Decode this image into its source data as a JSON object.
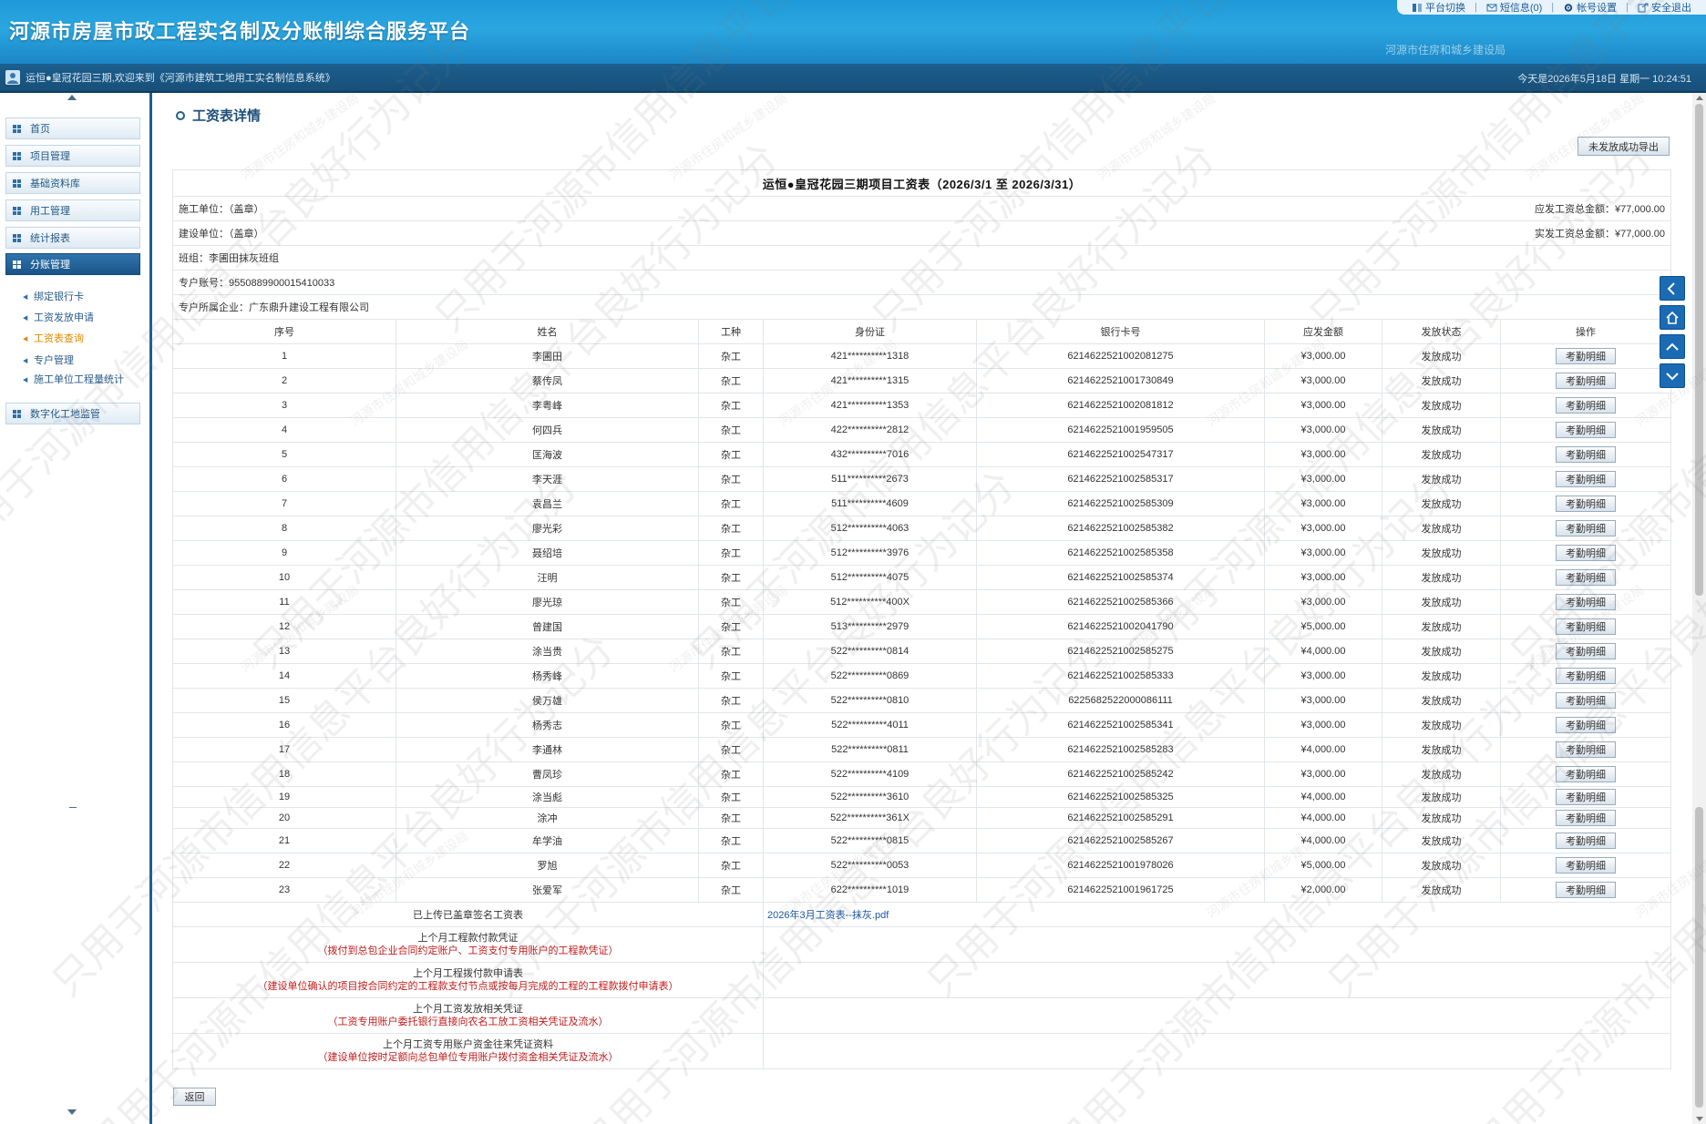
{
  "header": {
    "title": "河源市房屋市政工程实名制及分账制综合服务平台",
    "dept": "河源市住房和城乡建设局",
    "menu": {
      "switch": "平台切换",
      "messages": "短信息(0)",
      "account": "帐号设置",
      "logout": "安全退出",
      "separator": "|"
    }
  },
  "status": {
    "welcome": "运恒●皇冠花园三期,欢迎来到《河源市建筑工地用工实名制信息系统》",
    "date": "今天是2026年5月18日 星期一 10:24:51"
  },
  "sidebar": {
    "items": [
      {
        "label": "首页"
      },
      {
        "label": "项目管理"
      },
      {
        "label": "基础资料库"
      },
      {
        "label": "用工管理"
      },
      {
        "label": "统计报表"
      },
      {
        "label": "分账管理"
      }
    ],
    "subitems": [
      {
        "label": "绑定银行卡"
      },
      {
        "label": "工资发放申请"
      },
      {
        "label": "工资表查询"
      },
      {
        "label": "专户管理"
      },
      {
        "label": "施工单位工程量统计"
      }
    ],
    "extra": {
      "label": "数字化工地监管"
    }
  },
  "page": {
    "title": "工资表详情",
    "export_button": "未发放成功导出",
    "back_button": "返回"
  },
  "sheet": {
    "title": "运恒●皇冠花园三期项目工资表（2026/3/1 至 2026/3/31）",
    "constructor": "施工单位：（盖章）",
    "builder": "建设单位：（盖章）",
    "team": "班组：李圃田抹灰班组",
    "account": "专户账号：9550889900015410033",
    "enterprise": "专户所属企业：广东鼎升建设工程有限公司",
    "due_total": "应发工资总金额：¥77,000.00",
    "paid_total": "实发工资总金额：¥77,000.00",
    "columns": [
      "序号",
      "姓名",
      "工种",
      "身份证",
      "银行卡号",
      "应发金额",
      "发放状态",
      "操作"
    ],
    "detail_label": "考勤明细",
    "rows": [
      {
        "no": "1",
        "name": "李圃田",
        "job": "杂工",
        "id": "421**********1318",
        "card": "6214622521002081275",
        "amount": "¥3,000.00",
        "status": "发放成功"
      },
      {
        "no": "2",
        "name": "蔡传凤",
        "job": "杂工",
        "id": "421**********1315",
        "card": "6214622521001730849",
        "amount": "¥3,000.00",
        "status": "发放成功"
      },
      {
        "no": "3",
        "name": "李粤峰",
        "job": "杂工",
        "id": "421**********1353",
        "card": "6214622521002081812",
        "amount": "¥3,000.00",
        "status": "发放成功"
      },
      {
        "no": "4",
        "name": "何四兵",
        "job": "杂工",
        "id": "422**********2812",
        "card": "6214622521001959505",
        "amount": "¥3,000.00",
        "status": "发放成功"
      },
      {
        "no": "5",
        "name": "匡海波",
        "job": "杂工",
        "id": "432**********7016",
        "card": "6214622521002547317",
        "amount": "¥3,000.00",
        "status": "发放成功"
      },
      {
        "no": "6",
        "name": "李天涯",
        "job": "杂工",
        "id": "511**********2673",
        "card": "6214622521002585317",
        "amount": "¥3,000.00",
        "status": "发放成功"
      },
      {
        "no": "7",
        "name": "袁昌兰",
        "job": "杂工",
        "id": "511**********4609",
        "card": "6214622521002585309",
        "amount": "¥3,000.00",
        "status": "发放成功"
      },
      {
        "no": "8",
        "name": "廖光彩",
        "job": "杂工",
        "id": "512**********4063",
        "card": "6214622521002585382",
        "amount": "¥3,000.00",
        "status": "发放成功"
      },
      {
        "no": "9",
        "name": "聂绍培",
        "job": "杂工",
        "id": "512**********3976",
        "card": "6214622521002585358",
        "amount": "¥3,000.00",
        "status": "发放成功"
      },
      {
        "no": "10",
        "name": "汪明",
        "job": "杂工",
        "id": "512**********4075",
        "card": "6214622521002585374",
        "amount": "¥3,000.00",
        "status": "发放成功"
      },
      {
        "no": "11",
        "name": "廖光琼",
        "job": "杂工",
        "id": "512**********400X",
        "card": "6214622521002585366",
        "amount": "¥3,000.00",
        "status": "发放成功"
      },
      {
        "no": "12",
        "name": "曾建国",
        "job": "杂工",
        "id": "513**********2979",
        "card": "6214622521002041790",
        "amount": "¥5,000.00",
        "status": "发放成功"
      },
      {
        "no": "13",
        "name": "涂当贵",
        "job": "杂工",
        "id": "522**********0814",
        "card": "6214622521002585275",
        "amount": "¥4,000.00",
        "status": "发放成功"
      },
      {
        "no": "14",
        "name": "杨秀峰",
        "job": "杂工",
        "id": "522**********0869",
        "card": "6214622521002585333",
        "amount": "¥3,000.00",
        "status": "发放成功"
      },
      {
        "no": "15",
        "name": "侯万雄",
        "job": "杂工",
        "id": "522**********0810",
        "card": "6225682522000086111",
        "amount": "¥3,000.00",
        "status": "发放成功"
      },
      {
        "no": "16",
        "name": "杨秀志",
        "job": "杂工",
        "id": "522**********4011",
        "card": "6214622521002585341",
        "amount": "¥3,000.00",
        "status": "发放成功"
      },
      {
        "no": "17",
        "name": "李通林",
        "job": "杂工",
        "id": "522**********0811",
        "card": "6214622521002585283",
        "amount": "¥4,000.00",
        "status": "发放成功"
      },
      {
        "no": "18",
        "name": "曹凤珍",
        "job": "杂工",
        "id": "522**********4109",
        "card": "6214622521002585242",
        "amount": "¥3,000.00",
        "status": "发放成功"
      },
      {
        "no": "19",
        "name": "涂当彪",
        "job": "杂工",
        "id": "522**********3610",
        "card": "6214622521002585325",
        "amount": "¥4,000.00",
        "status": "发放成功"
      },
      {
        "no": "20",
        "name": "涂冲",
        "job": "杂工",
        "id": "522**********361X",
        "card": "6214622521002585291",
        "amount": "¥4,000.00",
        "status": "发放成功"
      },
      {
        "no": "21",
        "name": "牟学油",
        "job": "杂工",
        "id": "522**********0815",
        "card": "6214622521002585267",
        "amount": "¥4,000.00",
        "status": "发放成功"
      },
      {
        "no": "22",
        "name": "罗旭",
        "job": "杂工",
        "id": "522**********0053",
        "card": "6214622521001978026",
        "amount": "¥5,000.00",
        "status": "发放成功"
      },
      {
        "no": "23",
        "name": "张爱军",
        "job": "杂工",
        "id": "622**********1019",
        "card": "6214622521001961725",
        "amount": "¥2,000.00",
        "status": "发放成功"
      }
    ],
    "docs": {
      "uploaded_label": "已上传已盖章签名工资表",
      "uploaded_file": "2026年3月工资表--抹灰.pdf",
      "evidence": [
        {
          "title": "上个月工程款付款凭证",
          "note": "（拨付到总包企业合同约定账户、工资支付专用账户的工程款凭证）"
        },
        {
          "title": "上个月工程拨付款申请表",
          "note": "（建设单位确认的项目按合同约定的工程款支付节点或按每月完成的工程的工程款拨付申请表）"
        },
        {
          "title": "上个月工资发放相关凭证",
          "note": "（工资专用账户委托银行直接向农名工放工资相关凭证及流水）"
        },
        {
          "title": "上个月工资专用账户资金往来凭证资料",
          "note": "（建设单位按时足额向总包单位专用账户拨付资金相关凭证及流水）"
        }
      ]
    }
  },
  "watermark": {
    "large": "只用于河源市信用信息平台良好行为记分",
    "small": "河源市住房和城乡建设局"
  },
  "colors": {
    "header": "#2aa6e0",
    "statusbar": "#174f78",
    "sidebar_active": "#1a5487",
    "current_sub": "#e08a00",
    "evidence_note": "#c11a1a",
    "nav_button": "#1a6bb4"
  },
  "icons": {
    "switch": "switch-icon",
    "messages": "mail-icon",
    "account": "gear-icon",
    "logout": "logout-icon",
    "user": "user-icon",
    "nav_back": "chevron-left-icon",
    "nav_home": "home-icon",
    "nav_up": "chevron-up-icon",
    "nav_down": "chevron-down-icon"
  }
}
